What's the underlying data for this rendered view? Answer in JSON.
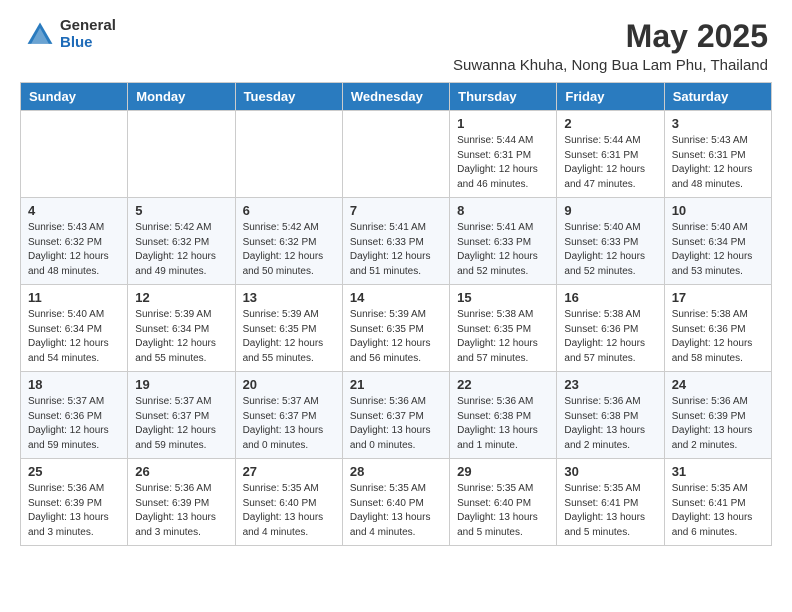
{
  "header": {
    "logo_general": "General",
    "logo_blue": "Blue",
    "title": "May 2025",
    "subtitle": "Suwanna Khuha, Nong Bua Lam Phu, Thailand"
  },
  "days_of_week": [
    "Sunday",
    "Monday",
    "Tuesday",
    "Wednesday",
    "Thursday",
    "Friday",
    "Saturday"
  ],
  "weeks": [
    [
      {
        "num": "",
        "info": ""
      },
      {
        "num": "",
        "info": ""
      },
      {
        "num": "",
        "info": ""
      },
      {
        "num": "",
        "info": ""
      },
      {
        "num": "1",
        "info": "Sunrise: 5:44 AM\nSunset: 6:31 PM\nDaylight: 12 hours\nand 46 minutes."
      },
      {
        "num": "2",
        "info": "Sunrise: 5:44 AM\nSunset: 6:31 PM\nDaylight: 12 hours\nand 47 minutes."
      },
      {
        "num": "3",
        "info": "Sunrise: 5:43 AM\nSunset: 6:31 PM\nDaylight: 12 hours\nand 48 minutes."
      }
    ],
    [
      {
        "num": "4",
        "info": "Sunrise: 5:43 AM\nSunset: 6:32 PM\nDaylight: 12 hours\nand 48 minutes."
      },
      {
        "num": "5",
        "info": "Sunrise: 5:42 AM\nSunset: 6:32 PM\nDaylight: 12 hours\nand 49 minutes."
      },
      {
        "num": "6",
        "info": "Sunrise: 5:42 AM\nSunset: 6:32 PM\nDaylight: 12 hours\nand 50 minutes."
      },
      {
        "num": "7",
        "info": "Sunrise: 5:41 AM\nSunset: 6:33 PM\nDaylight: 12 hours\nand 51 minutes."
      },
      {
        "num": "8",
        "info": "Sunrise: 5:41 AM\nSunset: 6:33 PM\nDaylight: 12 hours\nand 52 minutes."
      },
      {
        "num": "9",
        "info": "Sunrise: 5:40 AM\nSunset: 6:33 PM\nDaylight: 12 hours\nand 52 minutes."
      },
      {
        "num": "10",
        "info": "Sunrise: 5:40 AM\nSunset: 6:34 PM\nDaylight: 12 hours\nand 53 minutes."
      }
    ],
    [
      {
        "num": "11",
        "info": "Sunrise: 5:40 AM\nSunset: 6:34 PM\nDaylight: 12 hours\nand 54 minutes."
      },
      {
        "num": "12",
        "info": "Sunrise: 5:39 AM\nSunset: 6:34 PM\nDaylight: 12 hours\nand 55 minutes."
      },
      {
        "num": "13",
        "info": "Sunrise: 5:39 AM\nSunset: 6:35 PM\nDaylight: 12 hours\nand 55 minutes."
      },
      {
        "num": "14",
        "info": "Sunrise: 5:39 AM\nSunset: 6:35 PM\nDaylight: 12 hours\nand 56 minutes."
      },
      {
        "num": "15",
        "info": "Sunrise: 5:38 AM\nSunset: 6:35 PM\nDaylight: 12 hours\nand 57 minutes."
      },
      {
        "num": "16",
        "info": "Sunrise: 5:38 AM\nSunset: 6:36 PM\nDaylight: 12 hours\nand 57 minutes."
      },
      {
        "num": "17",
        "info": "Sunrise: 5:38 AM\nSunset: 6:36 PM\nDaylight: 12 hours\nand 58 minutes."
      }
    ],
    [
      {
        "num": "18",
        "info": "Sunrise: 5:37 AM\nSunset: 6:36 PM\nDaylight: 12 hours\nand 59 minutes."
      },
      {
        "num": "19",
        "info": "Sunrise: 5:37 AM\nSunset: 6:37 PM\nDaylight: 12 hours\nand 59 minutes."
      },
      {
        "num": "20",
        "info": "Sunrise: 5:37 AM\nSunset: 6:37 PM\nDaylight: 13 hours\nand 0 minutes."
      },
      {
        "num": "21",
        "info": "Sunrise: 5:36 AM\nSunset: 6:37 PM\nDaylight: 13 hours\nand 0 minutes."
      },
      {
        "num": "22",
        "info": "Sunrise: 5:36 AM\nSunset: 6:38 PM\nDaylight: 13 hours\nand 1 minute."
      },
      {
        "num": "23",
        "info": "Sunrise: 5:36 AM\nSunset: 6:38 PM\nDaylight: 13 hours\nand 2 minutes."
      },
      {
        "num": "24",
        "info": "Sunrise: 5:36 AM\nSunset: 6:39 PM\nDaylight: 13 hours\nand 2 minutes."
      }
    ],
    [
      {
        "num": "25",
        "info": "Sunrise: 5:36 AM\nSunset: 6:39 PM\nDaylight: 13 hours\nand 3 minutes."
      },
      {
        "num": "26",
        "info": "Sunrise: 5:36 AM\nSunset: 6:39 PM\nDaylight: 13 hours\nand 3 minutes."
      },
      {
        "num": "27",
        "info": "Sunrise: 5:35 AM\nSunset: 6:40 PM\nDaylight: 13 hours\nand 4 minutes."
      },
      {
        "num": "28",
        "info": "Sunrise: 5:35 AM\nSunset: 6:40 PM\nDaylight: 13 hours\nand 4 minutes."
      },
      {
        "num": "29",
        "info": "Sunrise: 5:35 AM\nSunset: 6:40 PM\nDaylight: 13 hours\nand 5 minutes."
      },
      {
        "num": "30",
        "info": "Sunrise: 5:35 AM\nSunset: 6:41 PM\nDaylight: 13 hours\nand 5 minutes."
      },
      {
        "num": "31",
        "info": "Sunrise: 5:35 AM\nSunset: 6:41 PM\nDaylight: 13 hours\nand 6 minutes."
      }
    ]
  ]
}
